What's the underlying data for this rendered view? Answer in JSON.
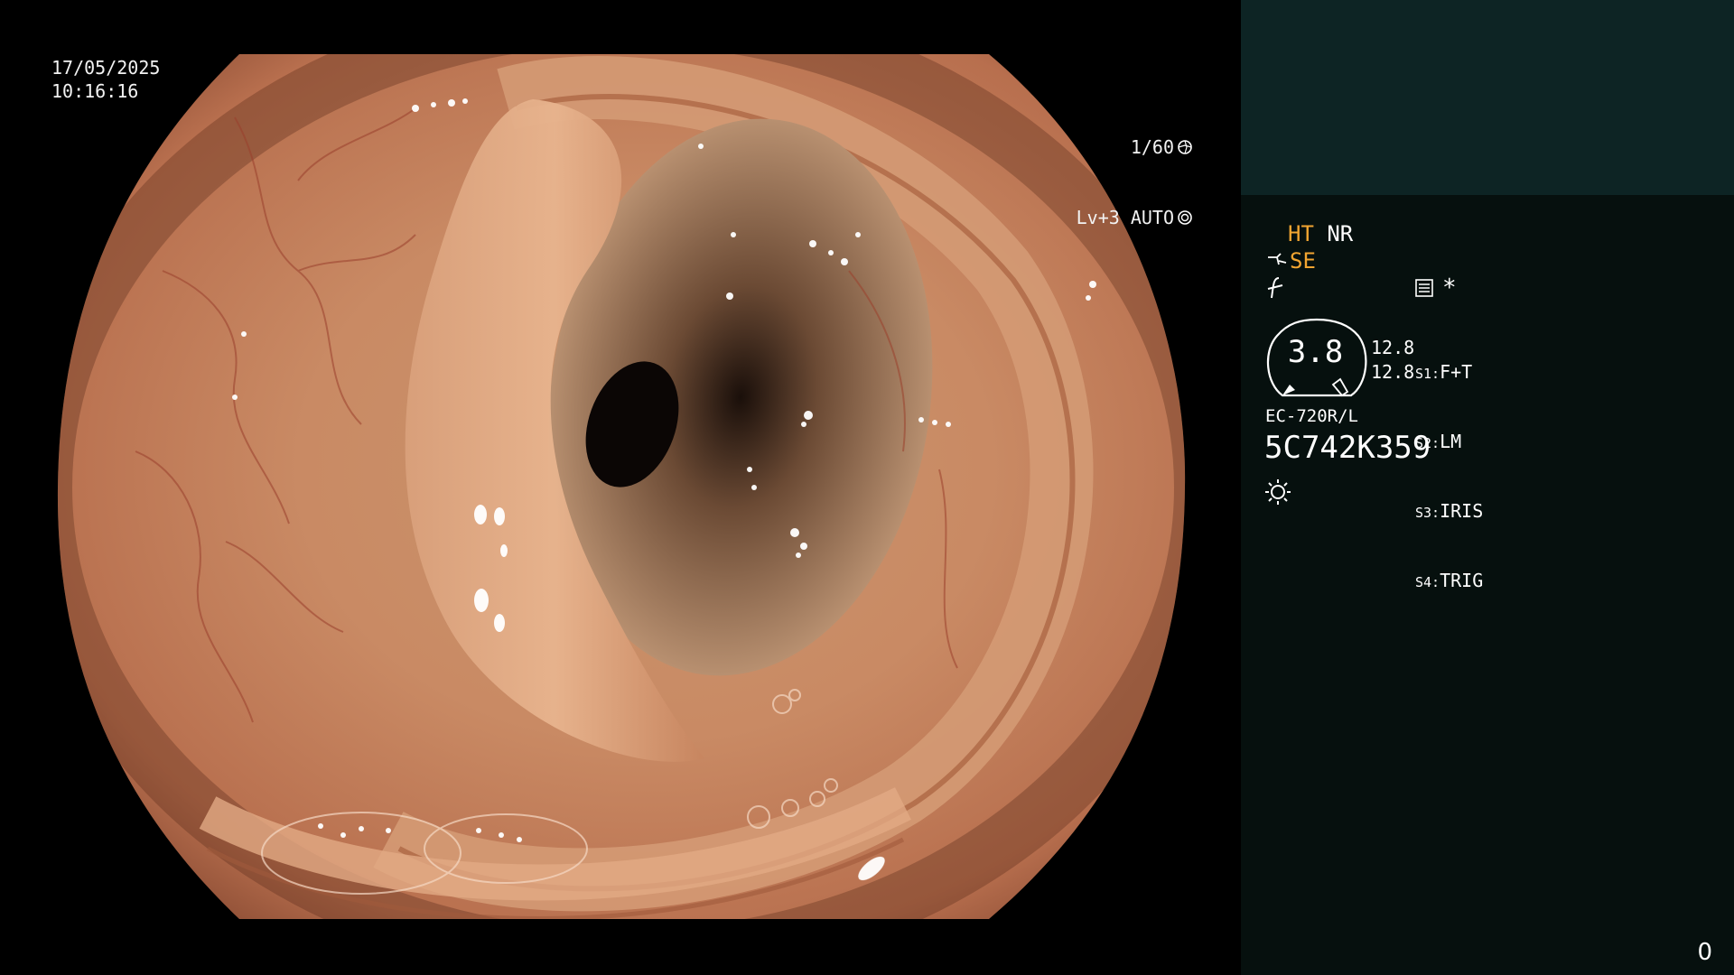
{
  "overlay": {
    "date": "17/05/2025",
    "time": "10:16:16",
    "shutter": "1/60",
    "level_auto": "Lv+3 AUTO"
  },
  "panel": {
    "mode_ht": "HT",
    "mode_nr": "NR",
    "mode_se": "SE",
    "star": "*",
    "gauge_value": "3.8",
    "val_1": "12.8",
    "val_2": "12.8",
    "switches": [
      {
        "key": "S1:",
        "label": "F+T"
      },
      {
        "key": "S2:",
        "label": "LM"
      },
      {
        "key": "S3:",
        "label": "IRIS"
      },
      {
        "key": "S4:",
        "label": "TRIG"
      }
    ],
    "scope_model": "EC-720R/L",
    "serial": "5C742K359",
    "counter": "0"
  },
  "colors": {
    "accent_orange": "#f2a531",
    "panel_dark": "#06100e",
    "panel_top": "#0d2424"
  },
  "icons": {
    "shutter": "shutter-icon",
    "auto": "auto-iris-icon",
    "pump": "pump-icon",
    "edge": "edge-enhance-icon",
    "menu": "settings-menu-icon",
    "light": "light-source-icon"
  }
}
